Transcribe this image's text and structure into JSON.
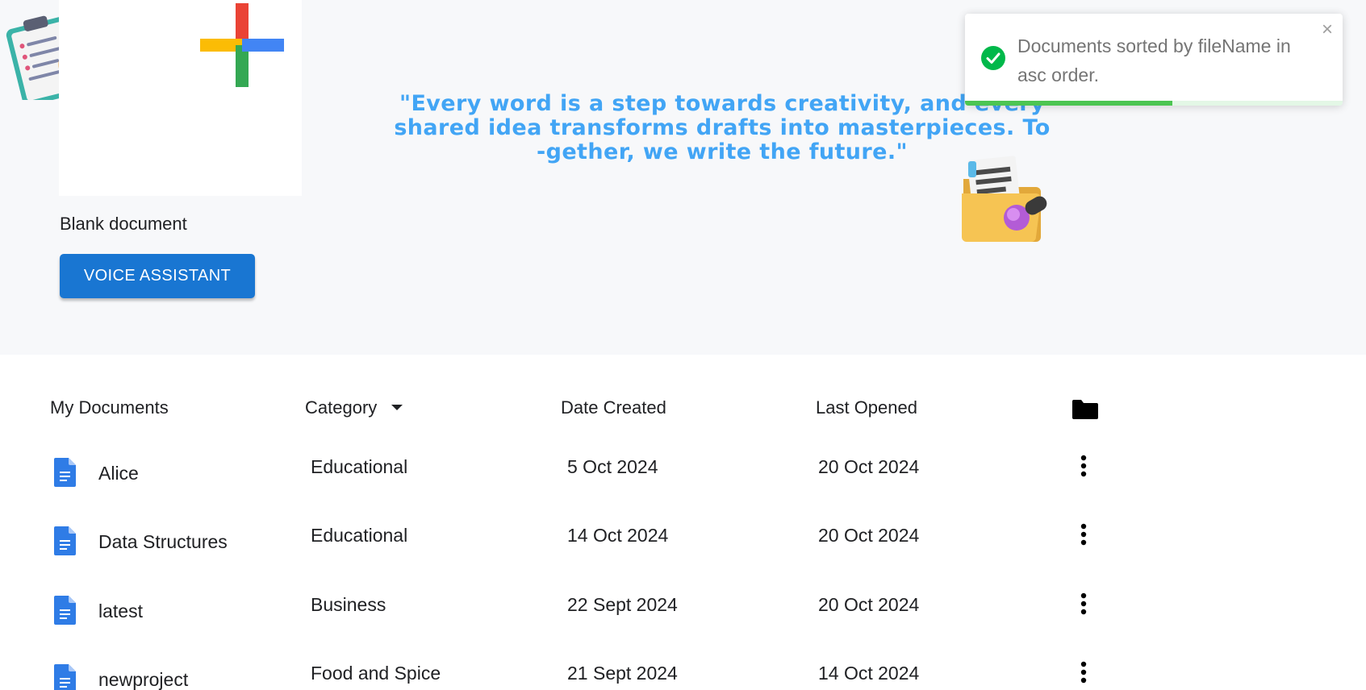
{
  "hero": {
    "blank_label": "Blank document",
    "voice_button": "VOICE ASSISTANT",
    "quote_lines": [
      "\"Every word is a step towards creativity, and every",
      "shared idea transforms drafts into masterpieces. To",
      "-gether, we write the future.\""
    ]
  },
  "toast": {
    "message": "Documents sorted by fileName in asc order.",
    "status_icon": "check-circle-icon",
    "close_glyph": "×",
    "progress": 0.55,
    "colors": {
      "success": "#00b84a",
      "progress": "#4cc552"
    }
  },
  "table": {
    "headers": {
      "name": "My Documents",
      "category": "Category",
      "created": "Date Created",
      "opened": "Last Opened"
    },
    "rows": [
      {
        "name": "Alice",
        "category": "Educational",
        "created": "5 Oct 2024",
        "opened": "20 Oct 2024"
      },
      {
        "name": "Data Structures",
        "category": "Educational",
        "created": "14 Oct 2024",
        "opened": "20 Oct 2024"
      },
      {
        "name": "latest",
        "category": "Business",
        "created": "22 Sept 2024",
        "opened": "20 Oct 2024"
      },
      {
        "name": "newproject",
        "category": "Food and Spice",
        "created": "21 Sept 2024",
        "opened": "14 Oct 2024"
      }
    ]
  },
  "colors": {
    "accent": "#1976d2",
    "quote": "#42a5f5",
    "doc_icon": "#2f7ce6"
  }
}
